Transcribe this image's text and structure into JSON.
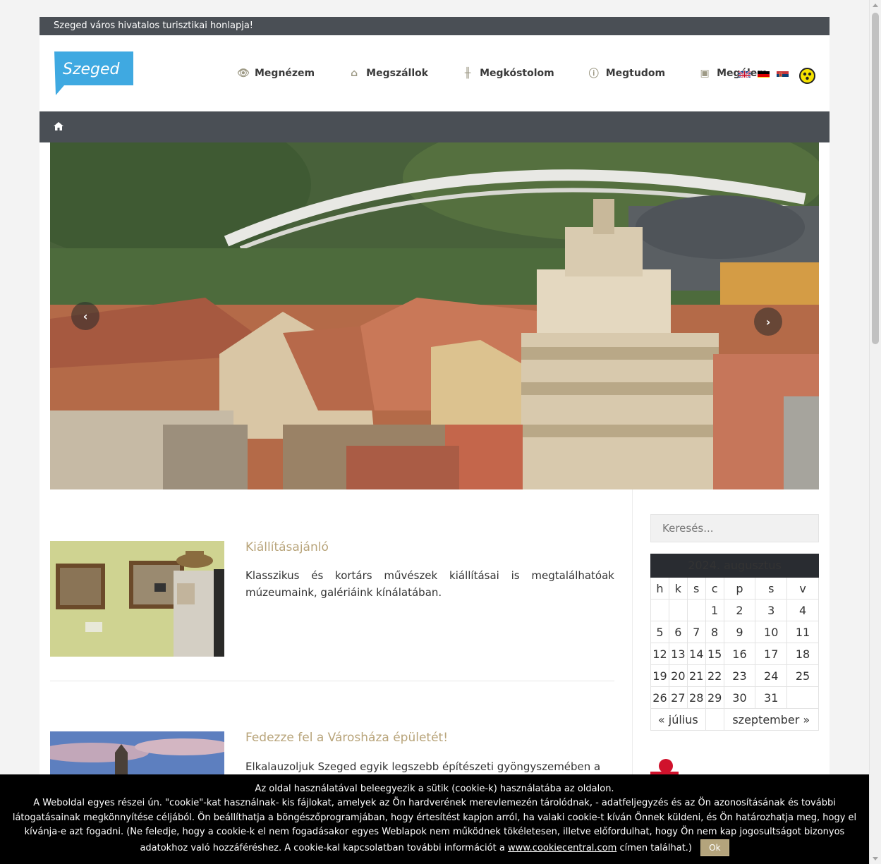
{
  "topbar": {
    "text": "Szeged város hivatalos turisztikai honlapja!"
  },
  "logo": {
    "text": "Szeged",
    "color": "#3fa9e1"
  },
  "nav": [
    {
      "label": "Megnézem",
      "icon": "eye-icon"
    },
    {
      "label": "Megszállok",
      "icon": "home-icon"
    },
    {
      "label": "Megkóstolom",
      "icon": "cutlery-icon"
    },
    {
      "label": "Megtudom",
      "icon": "info-icon"
    },
    {
      "label": "Megélem",
      "icon": "camera-icon"
    }
  ],
  "languages": [
    "en",
    "de",
    "sr"
  ],
  "slider": {
    "prev_label": "‹",
    "next_label": "›"
  },
  "posts": [
    {
      "title": "Kiállításajánló",
      "text": "Klasszikus és kortárs művészek kiállításai is megtalálhatóak múzeumaink, galériáink kínálatában."
    },
    {
      "title": "Fedezze fel a Városháza épületét!",
      "text": "Elkalauzoljuk Szeged egyik legszebb építészeti gyöngyszemében a"
    }
  ],
  "search": {
    "placeholder": "Keresés..."
  },
  "calendar": {
    "caption": "2024. augusztus",
    "weekdays": [
      "h",
      "k",
      "s",
      "c",
      "p",
      "s",
      "v"
    ],
    "weeks": [
      [
        "",
        "",
        "",
        "1",
        "2",
        "3",
        "4"
      ],
      [
        "5",
        "6",
        "7",
        "8",
        "9",
        "10",
        "11"
      ],
      [
        "12",
        "13",
        "14",
        "15",
        "16",
        "17",
        "18"
      ],
      [
        "19",
        "20",
        "21",
        "22",
        "23",
        "24",
        "25"
      ],
      [
        "26",
        "27",
        "28",
        "29",
        "30",
        "31",
        ""
      ]
    ],
    "prev": "« július",
    "next": "szeptember »"
  },
  "cookie": {
    "line1": "Az oldal használatával beleegyezik a sütik (cookie-k) használatába az oldalon.",
    "line2": "A Weboldal egyes részei ún. \"cookie\"-kat használnak- kis fájlokat, amelyek az Ön hardverének merevlemezén tárolódnak, - adatfeljegyzés és az Ön azonosításának és további látogatásainak megkönnyítése céljából. Ön beállíthatja a böngészőprogramjában, hogy értesítést kapjon arról, ha valaki cookie-t kíván Önnek küldeni, és Ön határozhatja meg, hogy el kívánja-e azt fogadni. (Ne feledje, hogy a cookie-k el nem fogadásakor egyes Weblapok nem működnek tökéletesen, illetve előfordulhat, hogy Ön nem kap jogosultságot bizonyos adatokhoz való hozzáféréshez. A cookie-kal kapcsolatban további információt a",
    "link": "www.cookiecentral.com",
    "line3": "címen találhat.)",
    "ok": "Ok"
  }
}
